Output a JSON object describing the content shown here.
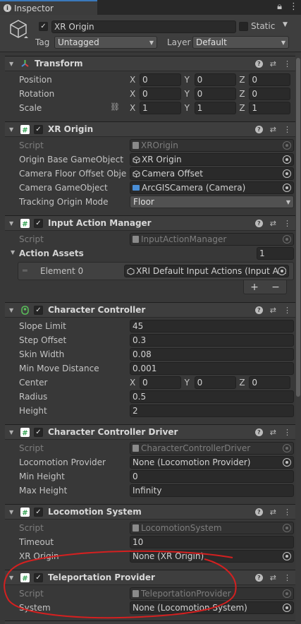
{
  "tab": {
    "title": "Inspector"
  },
  "gameobject": {
    "name": "XR Origin",
    "active": true,
    "static_label": "Static",
    "tag_label": "Tag",
    "tag_value": "Untagged",
    "layer_label": "Layer",
    "layer_value": "Default"
  },
  "transform": {
    "title": "Transform",
    "position": {
      "label": "Position",
      "x": "0",
      "y": "0",
      "z": "0"
    },
    "rotation": {
      "label": "Rotation",
      "x": "0",
      "y": "0",
      "z": "0"
    },
    "scale": {
      "label": "Scale",
      "x": "1",
      "y": "1",
      "z": "1"
    }
  },
  "xr_origin": {
    "title": "XR Origin",
    "script_label": "Script",
    "script_value": "XROrigin",
    "origin_label": "Origin Base GameObject",
    "origin_value": "XR Origin",
    "floor_label": "Camera Floor Offset Objec",
    "floor_value": "Camera Offset",
    "camera_label": "Camera GameObject",
    "camera_value": "ArcGISCamera (Camera)",
    "tracking_label": "Tracking Origin Mode",
    "tracking_value": "Floor"
  },
  "input_action_manager": {
    "title": "Input Action Manager",
    "script_label": "Script",
    "script_value": "InputActionManager",
    "assets_label": "Action Assets",
    "assets_count": "1",
    "element_label": "Element 0",
    "element_value": "XRI Default Input Actions (Input Act",
    "add": "+",
    "remove": "−"
  },
  "character_controller": {
    "title": "Character Controller",
    "slope_label": "Slope Limit",
    "slope_value": "45",
    "step_label": "Step Offset",
    "step_value": "0.3",
    "skin_label": "Skin Width",
    "skin_value": "0.08",
    "minmove_label": "Min Move Distance",
    "minmove_value": "0.001",
    "center": {
      "label": "Center",
      "x": "0",
      "y": "0",
      "z": "0"
    },
    "radius_label": "Radius",
    "radius_value": "0.5",
    "height_label": "Height",
    "height_value": "2"
  },
  "cc_driver": {
    "title": "Character Controller Driver",
    "script_label": "Script",
    "script_value": "CharacterControllerDriver",
    "loco_label": "Locomotion Provider",
    "loco_value": "None (Locomotion Provider)",
    "minh_label": "Min Height",
    "minh_value": "0",
    "maxh_label": "Max Height",
    "maxh_value": "Infinity"
  },
  "locomotion_system": {
    "title": "Locomotion System",
    "script_label": "Script",
    "script_value": "LocomotionSystem",
    "timeout_label": "Timeout",
    "timeout_value": "10",
    "xrorigin_label": "XR Origin",
    "xrorigin_value": "None (XR Origin)"
  },
  "teleportation_provider": {
    "title": "Teleportation Provider",
    "script_label": "Script",
    "script_value": "TeleportationProvider",
    "system_label": "System",
    "system_value": "None (Locomotion System)"
  },
  "axes": {
    "x": "X",
    "y": "Y",
    "z": "Z"
  },
  "colors": {
    "accent": "#3a79bb",
    "annotation": "#d42020"
  }
}
